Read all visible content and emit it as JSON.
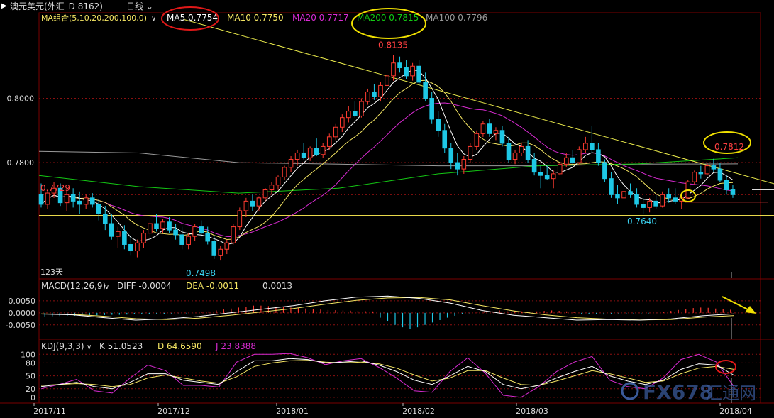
{
  "titlebar": {
    "symbol": "澳元美元(外汇_D 8162)",
    "period": "日线"
  },
  "colors": {
    "bull": "#ff3b30",
    "bear": "#1ec8e6",
    "ma5": "#ffffff",
    "ma10": "#f5e663",
    "ma20": "#d92bd2",
    "ma200": "#14c814",
    "ma100": "#9a9a9a",
    "trend": "#e8e84a",
    "support": "#e8d84a",
    "grid": "#8b1010",
    "annot_red": "#e01818",
    "annot_yellow": "#f0e000"
  },
  "price_legend": {
    "name": "MA组合(5,10,20,200,100,0)",
    "items": [
      {
        "label": "MA5 0.7754",
        "color": "#ffffff"
      },
      {
        "label": "MA10 0.7750",
        "color": "#f5e663"
      },
      {
        "label": "MA20 0.7717",
        "color": "#d92bd2"
      },
      {
        "label": "MA200 0.7815",
        "color": "#14c814"
      },
      {
        "label": "MA100 0.7796",
        "color": "#9a9a9a"
      }
    ]
  },
  "price_labels": {
    "high": "0.8135",
    "low_dec": "0.7498",
    "low_mar": "0.7640",
    "start": "0.7729",
    "recent_high": "0.7812",
    "days": "123天"
  },
  "macd_legend": {
    "name": "MACD(12,26,9)",
    "diff": "DIFF  -0.0004",
    "dea": "DEA  -0.0011",
    "macd": "0.0013"
  },
  "kdj_legend": {
    "name": "KDJ(9,3,3)",
    "k": "K  51.0523",
    "d": "D  64.6590",
    "j": "J  23.8388"
  },
  "watermark": {
    "brand": "FX678",
    "cn": "汇通网"
  },
  "chart_data": [
    {
      "type": "candlestick",
      "title": "澳元美元(外汇_D 8162) 日线",
      "x_ticks": [
        "2017/11",
        "2017/12",
        "2018/01",
        "2018/02",
        "2018/03",
        "2018/04"
      ],
      "y_ticks": [
        "0.8000",
        "0.7800"
      ],
      "ylim": [
        0.744,
        0.82
      ],
      "candles": [
        [
          0.77,
          0.7735,
          0.766,
          0.767
        ],
        [
          0.767,
          0.7715,
          0.7655,
          0.7705
        ],
        [
          0.7705,
          0.774,
          0.769,
          0.772
        ],
        [
          0.772,
          0.7735,
          0.7665,
          0.7675
        ],
        [
          0.7675,
          0.7715,
          0.765,
          0.77
        ],
        [
          0.77,
          0.772,
          0.766,
          0.768
        ],
        [
          0.768,
          0.771,
          0.764,
          0.767
        ],
        [
          0.767,
          0.77,
          0.7655,
          0.769
        ],
        [
          0.769,
          0.7705,
          0.766,
          0.767
        ],
        [
          0.767,
          0.7685,
          0.762,
          0.764
        ],
        [
          0.764,
          0.7665,
          0.759,
          0.761
        ],
        [
          0.761,
          0.764,
          0.756,
          0.757
        ],
        [
          0.757,
          0.76,
          0.7535,
          0.7585
        ],
        [
          0.7585,
          0.7605,
          0.753,
          0.7545
        ],
        [
          0.7545,
          0.757,
          0.751,
          0.7525
        ],
        [
          0.7525,
          0.756,
          0.7505,
          0.755
        ],
        [
          0.755,
          0.759,
          0.7535,
          0.758
        ],
        [
          0.758,
          0.762,
          0.756,
          0.761
        ],
        [
          0.761,
          0.764,
          0.7585,
          0.7595
        ],
        [
          0.7595,
          0.7625,
          0.758,
          0.7615
        ],
        [
          0.7615,
          0.763,
          0.758,
          0.759
        ],
        [
          0.759,
          0.761,
          0.756,
          0.7575
        ],
        [
          0.7575,
          0.76,
          0.753,
          0.7545
        ],
        [
          0.7545,
          0.758,
          0.753,
          0.757
        ],
        [
          0.757,
          0.761,
          0.7555,
          0.76
        ],
        [
          0.76,
          0.762,
          0.757,
          0.758
        ],
        [
          0.758,
          0.76,
          0.7545,
          0.7555
        ],
        [
          0.7555,
          0.757,
          0.75,
          0.751
        ],
        [
          0.751,
          0.754,
          0.7495,
          0.753
        ],
        [
          0.753,
          0.756,
          0.7515,
          0.755
        ],
        [
          0.755,
          0.761,
          0.7545,
          0.76
        ],
        [
          0.76,
          0.766,
          0.759,
          0.765
        ],
        [
          0.765,
          0.769,
          0.763,
          0.768
        ],
        [
          0.768,
          0.77,
          0.765,
          0.7665
        ],
        [
          0.7665,
          0.7695,
          0.765,
          0.769
        ],
        [
          0.769,
          0.772,
          0.768,
          0.7715
        ],
        [
          0.7715,
          0.774,
          0.77,
          0.773
        ],
        [
          0.773,
          0.776,
          0.7715,
          0.7755
        ],
        [
          0.7755,
          0.779,
          0.7745,
          0.7785
        ],
        [
          0.7785,
          0.782,
          0.777,
          0.781
        ],
        [
          0.781,
          0.784,
          0.779,
          0.783
        ],
        [
          0.783,
          0.786,
          0.781,
          0.7815
        ],
        [
          0.7815,
          0.785,
          0.7805,
          0.7845
        ],
        [
          0.7845,
          0.7875,
          0.782,
          0.7825
        ],
        [
          0.7825,
          0.786,
          0.7815,
          0.785
        ],
        [
          0.785,
          0.789,
          0.784,
          0.788
        ],
        [
          0.788,
          0.792,
          0.787,
          0.791
        ],
        [
          0.791,
          0.795,
          0.7895,
          0.794
        ],
        [
          0.794,
          0.7975,
          0.7925,
          0.796
        ],
        [
          0.796,
          0.799,
          0.794,
          0.7945
        ],
        [
          0.7945,
          0.8,
          0.794,
          0.799
        ],
        [
          0.799,
          0.803,
          0.798,
          0.802
        ],
        [
          0.802,
          0.8045,
          0.7995,
          0.8005
        ],
        [
          0.8005,
          0.805,
          0.799,
          0.804
        ],
        [
          0.804,
          0.808,
          0.803,
          0.807
        ],
        [
          0.807,
          0.8135,
          0.8055,
          0.811
        ],
        [
          0.811,
          0.813,
          0.808,
          0.8095
        ],
        [
          0.8095,
          0.812,
          0.806,
          0.807
        ],
        [
          0.807,
          0.811,
          0.8055,
          0.81
        ],
        [
          0.81,
          0.812,
          0.804,
          0.805
        ],
        [
          0.805,
          0.808,
          0.799,
          0.8
        ],
        [
          0.8,
          0.802,
          0.792,
          0.7935
        ],
        [
          0.7935,
          0.796,
          0.788,
          0.79
        ],
        [
          0.79,
          0.792,
          0.783,
          0.7845
        ],
        [
          0.7845,
          0.786,
          0.778,
          0.78
        ],
        [
          0.78,
          0.783,
          0.776,
          0.778
        ],
        [
          0.778,
          0.782,
          0.7765,
          0.781
        ],
        [
          0.781,
          0.786,
          0.78,
          0.785
        ],
        [
          0.785,
          0.79,
          0.784,
          0.789
        ],
        [
          0.789,
          0.793,
          0.788,
          0.792
        ],
        [
          0.792,
          0.7935,
          0.788,
          0.789
        ],
        [
          0.789,
          0.791,
          0.787,
          0.79
        ],
        [
          0.79,
          0.7915,
          0.785,
          0.786
        ],
        [
          0.786,
          0.788,
          0.78,
          0.781
        ],
        [
          0.781,
          0.784,
          0.7795,
          0.783
        ],
        [
          0.783,
          0.786,
          0.782,
          0.785
        ],
        [
          0.785,
          0.787,
          0.78,
          0.781
        ],
        [
          0.781,
          0.783,
          0.776,
          0.777
        ],
        [
          0.777,
          0.779,
          0.772,
          0.776
        ],
        [
          0.776,
          0.779,
          0.7745,
          0.775
        ],
        [
          0.775,
          0.7775,
          0.772,
          0.7765
        ],
        [
          0.7765,
          0.78,
          0.776,
          0.7795
        ],
        [
          0.7795,
          0.783,
          0.7785,
          0.7815
        ],
        [
          0.7815,
          0.784,
          0.779,
          0.78
        ],
        [
          0.78,
          0.785,
          0.7795,
          0.784
        ],
        [
          0.784,
          0.788,
          0.783,
          0.786
        ],
        [
          0.786,
          0.7915,
          0.783,
          0.784
        ],
        [
          0.784,
          0.786,
          0.779,
          0.78
        ],
        [
          0.78,
          0.781,
          0.774,
          0.775
        ],
        [
          0.775,
          0.777,
          0.769,
          0.77
        ],
        [
          0.77,
          0.773,
          0.767,
          0.769
        ],
        [
          0.769,
          0.772,
          0.7675,
          0.771
        ],
        [
          0.771,
          0.7735,
          0.769,
          0.77
        ],
        [
          0.77,
          0.772,
          0.766,
          0.767
        ],
        [
          0.767,
          0.769,
          0.764,
          0.766
        ],
        [
          0.766,
          0.769,
          0.7645,
          0.768
        ],
        [
          0.768,
          0.77,
          0.7655,
          0.7665
        ],
        [
          0.7665,
          0.771,
          0.766,
          0.77
        ],
        [
          0.77,
          0.772,
          0.7675,
          0.769
        ],
        [
          0.769,
          0.772,
          0.767,
          0.768
        ],
        [
          0.768,
          0.77,
          0.7655,
          0.769
        ],
        [
          0.769,
          0.7745,
          0.7685,
          0.774
        ],
        [
          0.774,
          0.7775,
          0.773,
          0.777
        ],
        [
          0.777,
          0.779,
          0.775,
          0.7765
        ],
        [
          0.7765,
          0.78,
          0.776,
          0.779
        ],
        [
          0.779,
          0.7812,
          0.777,
          0.778
        ],
        [
          0.778,
          0.78,
          0.774,
          0.7745
        ],
        [
          0.7745,
          0.776,
          0.77,
          0.7715
        ],
        [
          0.7715,
          0.773,
          0.769,
          0.77
        ]
      ],
      "ma200": [
        0.776,
        0.7725,
        0.7705,
        0.772,
        0.7765,
        0.779,
        0.7796,
        0.7815
      ],
      "ma100": [
        0.7835,
        0.783,
        0.78,
        0.7795,
        0.779,
        0.779,
        0.7795,
        0.7796
      ],
      "trendline": {
        "from_high": 0.8135,
        "to_value": 0.7765
      },
      "support_levels": [
        0.764,
        0.7688
      ],
      "labels_values": {
        "high": 0.8135,
        "low_dec": 0.7498,
        "low_mar": 0.764,
        "recent_high": 0.7812
      }
    },
    {
      "type": "bar",
      "title": "MACD(12,26,9)",
      "y_ticks": [
        "0.0050",
        "0.0000",
        "-0.0050"
      ],
      "ylim": [
        -0.0095,
        0.01
      ],
      "histogram": [
        -0.0015,
        -0.0014,
        -0.0013,
        -0.0012,
        -0.0012,
        -0.0011,
        -0.001,
        -0.001,
        -0.0009,
        -0.0008,
        -0.0008,
        -0.0007,
        -0.0006,
        -0.0006,
        -0.0005,
        -0.0005,
        -0.0004,
        -0.0003,
        -0.0003,
        -0.0002,
        -0.0001,
        0.0003,
        0.0006,
        0.001,
        0.0014,
        0.0018,
        0.0022,
        0.0026,
        0.003,
        0.003,
        0.0028,
        0.0026,
        0.0024,
        0.0022,
        0.002,
        0.0018,
        0.0016,
        0.0014,
        0.0012,
        0.0011,
        0.001,
        0.0009,
        0.0008,
        0.0007,
        0.0006,
        -0.002,
        -0.0035,
        -0.005,
        -0.006,
        -0.0068,
        -0.006,
        -0.005,
        -0.004,
        -0.003,
        -0.002,
        -0.0012,
        -0.0006,
        -0.0002,
        0.0005,
        0.0007,
        0.0008,
        0.001,
        0.0009,
        0.0007,
        0.0006,
        0.0005,
        0.0006,
        0.0008,
        0.001,
        0.0008,
        0.0006,
        0.0004,
        -0.0003,
        -0.0005,
        -0.0006,
        -0.0007,
        -0.0006,
        -0.0005,
        -0.0004,
        -0.0003,
        -0.0003,
        -0.0002,
        -0.0001,
        0.0004,
        0.0008,
        0.0012,
        0.0016,
        0.002,
        0.0022,
        0.0021,
        0.0018,
        0.0015,
        0.0013
      ],
      "diff": [
        -0.0005,
        -0.0008,
        -0.002,
        -0.003,
        -0.0025,
        -0.0015,
        0.0,
        0.0015,
        0.003,
        0.005,
        0.0065,
        0.007,
        0.006,
        0.004,
        0.001,
        -0.001,
        -0.002,
        -0.003,
        -0.0028,
        -0.003,
        -0.0025,
        -0.0012,
        -0.0004
      ],
      "dea": [
        -0.0004,
        -0.0006,
        -0.0014,
        -0.0024,
        -0.0028,
        -0.0022,
        -0.001,
        0.0004,
        0.0018,
        0.0036,
        0.0052,
        0.0062,
        0.0064,
        0.0054,
        0.003,
        0.0008,
        -0.0008,
        -0.002,
        -0.0026,
        -0.0029,
        -0.0028,
        -0.0018,
        -0.0011
      ]
    },
    {
      "type": "line",
      "title": "KDJ(9,3,3)",
      "y_ticks": [
        "100",
        "80",
        "50",
        "20",
        "0"
      ],
      "ylim": [
        -10,
        112
      ],
      "k": [
        25,
        30,
        35,
        25,
        20,
        35,
        55,
        55,
        40,
        35,
        30,
        60,
        85,
        85,
        90,
        88,
        80,
        82,
        85,
        75,
        60,
        40,
        30,
        50,
        72,
        60,
        30,
        20,
        28,
        45,
        60,
        72,
        50,
        38,
        30,
        40,
        65,
        78,
        75,
        51
      ],
      "d": [
        28,
        30,
        32,
        30,
        25,
        30,
        45,
        52,
        45,
        38,
        33,
        48,
        72,
        80,
        85,
        86,
        82,
        80,
        82,
        78,
        68,
        52,
        38,
        45,
        62,
        62,
        45,
        30,
        28,
        38,
        50,
        62,
        55,
        45,
        35,
        38,
        55,
        68,
        72,
        65
      ],
      "j": [
        20,
        30,
        42,
        15,
        10,
        45,
        75,
        62,
        28,
        28,
        24,
        82,
        100,
        100,
        102,
        92,
        76,
        85,
        90,
        70,
        45,
        15,
        12,
        60,
        92,
        56,
        5,
        0,
        25,
        60,
        82,
        95,
        40,
        25,
        20,
        45,
        88,
        100,
        82,
        24
      ]
    }
  ]
}
